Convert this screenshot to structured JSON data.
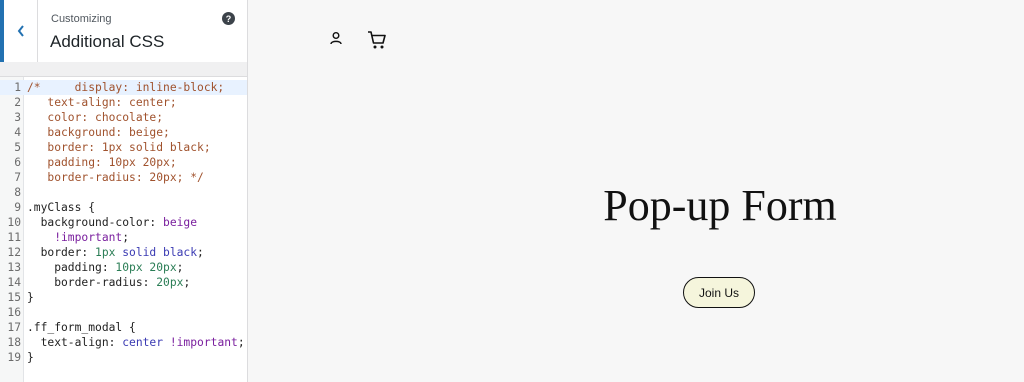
{
  "header": {
    "subtitle": "Customizing",
    "title": "Additional CSS",
    "help_label": "?"
  },
  "editor": {
    "line_numbers": [
      "1",
      "2",
      "3",
      "4",
      "5",
      "6",
      "7",
      "8",
      "9",
      "10",
      "11",
      "12",
      "13",
      "14",
      "15",
      "16",
      "17",
      "18",
      "19"
    ],
    "lines": [
      [
        {
          "t": "cm",
          "v": "/*     display: inline-block;"
        }
      ],
      [
        {
          "t": "cm",
          "v": "   text-align: center;"
        }
      ],
      [
        {
          "t": "cm",
          "v": "   color: chocolate;"
        }
      ],
      [
        {
          "t": "cm",
          "v": "   background: beige;"
        }
      ],
      [
        {
          "t": "cm",
          "v": "   border: 1px solid black;"
        }
      ],
      [
        {
          "t": "cm",
          "v": "   padding: 10px 20px;"
        }
      ],
      [
        {
          "t": "cm",
          "v": "   border-radius: 20px; */"
        }
      ],
      [],
      [
        {
          "t": "sel",
          "v": ".myClass {"
        }
      ],
      [
        {
          "t": "prop",
          "v": "  background-color: "
        },
        {
          "t": "val",
          "v": "beige"
        }
      ],
      [
        {
          "t": "val",
          "v": "    !important"
        },
        {
          "t": "prop",
          "v": ";"
        }
      ],
      [
        {
          "t": "prop",
          "v": "  border: "
        },
        {
          "t": "num",
          "v": "1px"
        },
        {
          "t": "kw",
          "v": " solid black"
        },
        {
          "t": "prop",
          "v": ";"
        }
      ],
      [
        {
          "t": "prop",
          "v": "    padding: "
        },
        {
          "t": "num",
          "v": "10px 20px"
        },
        {
          "t": "prop",
          "v": ";"
        }
      ],
      [
        {
          "t": "prop",
          "v": "    border-radius: "
        },
        {
          "t": "num",
          "v": "20px"
        },
        {
          "t": "prop",
          "v": ";"
        }
      ],
      [
        {
          "t": "sel",
          "v": "}"
        }
      ],
      [],
      [
        {
          "t": "sel",
          "v": ".ff_form_modal {"
        }
      ],
      [
        {
          "t": "prop",
          "v": "  text-align: "
        },
        {
          "t": "kw",
          "v": "center"
        },
        {
          "t": "val",
          "v": " !important"
        },
        {
          "t": "prop",
          "v": ";"
        }
      ],
      [
        {
          "t": "sel",
          "v": "}"
        }
      ]
    ]
  },
  "preview": {
    "account_icon": "user-icon",
    "cart_icon": "cart-icon",
    "title": "Pop-up Form",
    "button_label": "Join Us"
  },
  "colors": {
    "accent": "#2271b1",
    "button_bg": "#f5f5dc",
    "comment": "#a0522d"
  }
}
